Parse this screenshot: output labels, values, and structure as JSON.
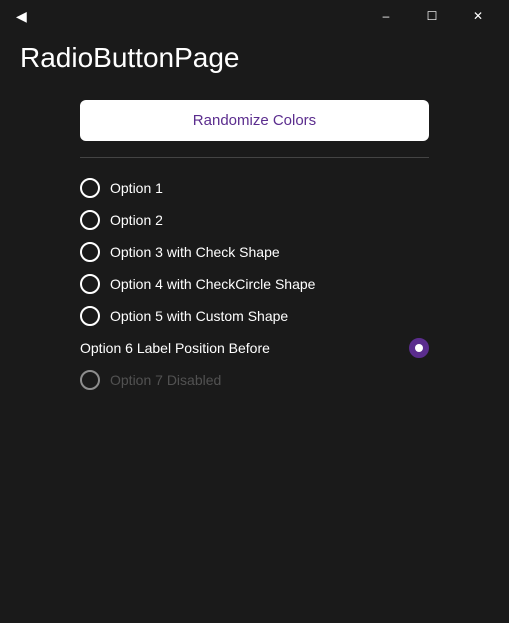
{
  "titleBar": {
    "backIcon": "◀",
    "minimizeIcon": "─",
    "maximizeIcon": "☐",
    "closeIcon": "✕"
  },
  "pageTitle": "RadioButtonPage",
  "randomizeBtn": "Randomize Colors",
  "radioOptions": [
    {
      "id": "opt1",
      "label": "Option 1",
      "selected": false,
      "disabled": false,
      "shape": "default",
      "labelBefore": false
    },
    {
      "id": "opt2",
      "label": "Option 2",
      "selected": false,
      "disabled": false,
      "shape": "default",
      "labelBefore": false
    },
    {
      "id": "opt3",
      "label": "Option 3 with Check Shape",
      "selected": false,
      "disabled": false,
      "shape": "check",
      "labelBefore": false
    },
    {
      "id": "opt4",
      "label": "Option 4 with CheckCircle Shape",
      "selected": false,
      "disabled": false,
      "shape": "checkcircle",
      "labelBefore": false
    },
    {
      "id": "opt5",
      "label": "Option 5 with Custom Shape",
      "selected": false,
      "disabled": false,
      "shape": "custom",
      "labelBefore": false
    },
    {
      "id": "opt6",
      "label": "Option 6 Label Position Before",
      "selected": true,
      "disabled": false,
      "shape": "default",
      "labelBefore": true
    },
    {
      "id": "opt7",
      "label": "Option 7 Disabled",
      "selected": false,
      "disabled": true,
      "shape": "default",
      "labelBefore": false
    }
  ]
}
